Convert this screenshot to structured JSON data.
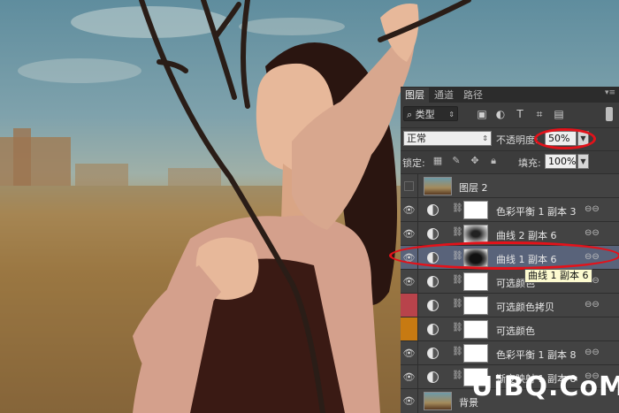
{
  "panel": {
    "tabs": [
      "图层",
      "通道",
      "路径"
    ],
    "filter_kind": "类型",
    "blend_mode": "正常",
    "opacity_label": "不透明度:",
    "opacity_value": "50%",
    "lock_label": "锁定:",
    "fill_label": "填充:",
    "fill_value": "100%"
  },
  "layers": [
    {
      "name": "图层 2",
      "visible": false,
      "selected": false
    },
    {
      "name": "色彩平衡 1 副本 3",
      "visible": true,
      "selected": false
    },
    {
      "name": "曲线 2 副本 6",
      "visible": true,
      "selected": false
    },
    {
      "name": "曲线 1 副本 6",
      "visible": true,
      "selected": true
    },
    {
      "name": "可选颜色",
      "visible": true,
      "selected": false
    },
    {
      "name": "可选颜色拷贝",
      "visible": true,
      "selected": false,
      "eye_color": "#b8434b"
    },
    {
      "name": "可选颜色",
      "visible": true,
      "selected": false,
      "eye_color": "#c77a12"
    },
    {
      "name": "色彩平衡 1 副本 8",
      "visible": true,
      "selected": false
    },
    {
      "name": "渐变映射 1 副本 8",
      "visible": true,
      "selected": false
    },
    {
      "name": "背景",
      "visible": true,
      "selected": false
    }
  ],
  "tooltip": "曲线 1 副本 6",
  "watermark": "UiBQ.CoM",
  "colors": {
    "highlight": "#e3121a",
    "selected_row": "#59637a"
  }
}
